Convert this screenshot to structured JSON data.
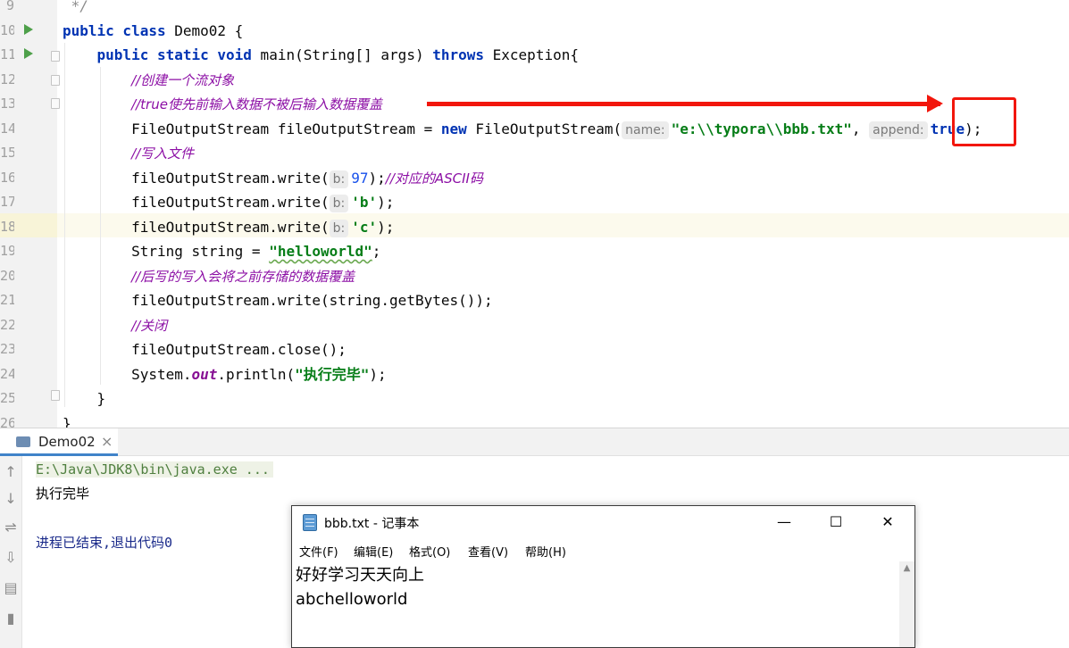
{
  "editor": {
    "lines": [
      {
        "num": "9",
        "parts": [
          {
            "t": " */",
            "c": "cmt2"
          }
        ]
      },
      {
        "num": "10",
        "parts": [
          {
            "t": "public class",
            "c": "kw"
          },
          {
            "t": " Demo02 {",
            "c": ""
          }
        ]
      },
      {
        "num": "11",
        "parts": [
          {
            "t": "    ",
            "c": ""
          },
          {
            "t": "public static void",
            "c": "kw"
          },
          {
            "t": " main(String[] args) ",
            "c": ""
          },
          {
            "t": "throws",
            "c": "kw"
          },
          {
            "t": " Exception{",
            "c": ""
          }
        ]
      },
      {
        "num": "12",
        "parts": [
          {
            "t": "        ",
            "c": ""
          },
          {
            "t": "//创建一个流对象",
            "c": "cmt"
          }
        ]
      },
      {
        "num": "13",
        "parts": [
          {
            "t": "        ",
            "c": ""
          },
          {
            "t": "//true使先前输入数据不被后输入数据覆盖",
            "c": "cmt"
          }
        ]
      },
      {
        "num": "14",
        "parts": [
          {
            "t": "        FileOutputStream fileOutputStream = ",
            "c": ""
          },
          {
            "t": "new",
            "c": "kw"
          },
          {
            "t": " FileOutputStream(",
            "c": ""
          },
          {
            "t": "name:",
            "c": "hint"
          },
          {
            "t": "\"e:\\\\typora\\\\bbb.txt\"",
            "c": "str"
          },
          {
            "t": ", ",
            "c": ""
          },
          {
            "t": "append:",
            "c": "hint"
          },
          {
            "t": "true",
            "c": "kw"
          },
          {
            "t": ");",
            "c": ""
          }
        ]
      },
      {
        "num": "15",
        "parts": [
          {
            "t": "        ",
            "c": ""
          },
          {
            "t": "//写入文件",
            "c": "cmt"
          }
        ]
      },
      {
        "num": "16",
        "parts": [
          {
            "t": "        fileOutputStream.write(",
            "c": ""
          },
          {
            "t": "b:",
            "c": "hint"
          },
          {
            "t": "97",
            "c": "num"
          },
          {
            "t": ");",
            "c": ""
          },
          {
            "t": "//对应的ASCII码",
            "c": "cmt"
          }
        ]
      },
      {
        "num": "17",
        "parts": [
          {
            "t": "        fileOutputStream.write(",
            "c": ""
          },
          {
            "t": "b:",
            "c": "hint"
          },
          {
            "t": "'b'",
            "c": "str"
          },
          {
            "t": ");",
            "c": ""
          }
        ]
      },
      {
        "num": "18",
        "parts": [
          {
            "t": "        fileOutputStream.write(",
            "c": ""
          },
          {
            "t": "b:",
            "c": "hint"
          },
          {
            "t": "'c'",
            "c": "str"
          },
          {
            "t": ");",
            "c": ""
          }
        ]
      },
      {
        "num": "19",
        "parts": [
          {
            "t": "        String string = ",
            "c": ""
          },
          {
            "t": "\"helloworld\"",
            "c": "str squig"
          },
          {
            "t": ";",
            "c": ""
          }
        ]
      },
      {
        "num": "20",
        "parts": [
          {
            "t": "        ",
            "c": ""
          },
          {
            "t": "//后写的写入会将之前存储的数据覆盖",
            "c": "cmt"
          }
        ]
      },
      {
        "num": "21",
        "parts": [
          {
            "t": "        fileOutputStream.write(string.getBytes());",
            "c": ""
          }
        ]
      },
      {
        "num": "22",
        "parts": [
          {
            "t": "        ",
            "c": ""
          },
          {
            "t": "//关闭",
            "c": "cmt"
          }
        ]
      },
      {
        "num": "23",
        "parts": [
          {
            "t": "        fileOutputStream.close();",
            "c": ""
          }
        ]
      },
      {
        "num": "24",
        "parts": [
          {
            "t": "        System.",
            "c": ""
          },
          {
            "t": "out",
            "c": "fld"
          },
          {
            "t": ".println(",
            "c": ""
          },
          {
            "t": "\"执行完毕\"",
            "c": "str"
          },
          {
            "t": ");",
            "c": ""
          }
        ]
      },
      {
        "num": "25",
        "parts": [
          {
            "t": "    }",
            "c": ""
          }
        ]
      },
      {
        "num": "26",
        "parts": [
          {
            "t": "}",
            "c": ""
          }
        ]
      }
    ]
  },
  "run_panel": {
    "tab_label": "Demo02",
    "tab_close": "×",
    "command": "E:\\Java\\JDK8\\bin\\java.exe ...",
    "output": "执行完毕",
    "exit_message": "进程已结束,退出代码0"
  },
  "notepad": {
    "title": "bbb.txt - 记事本",
    "minimize": "—",
    "maximize": "☐",
    "close": "✕",
    "menus": [
      "文件(F)",
      "编辑(E)",
      "格式(O)",
      "查看(V)",
      "帮助(H)"
    ],
    "content": [
      "好好学习天天向上",
      "abchelloworld"
    ]
  },
  "icons": {
    "run": "run-triangle-icon",
    "fold": "fold-marker-icon",
    "notepad": "notepad-icon"
  },
  "colors": {
    "keyword": "#0033b3",
    "comment": "#8c0fa5",
    "string": "#067d17",
    "annotation_red": "#f2160c"
  }
}
